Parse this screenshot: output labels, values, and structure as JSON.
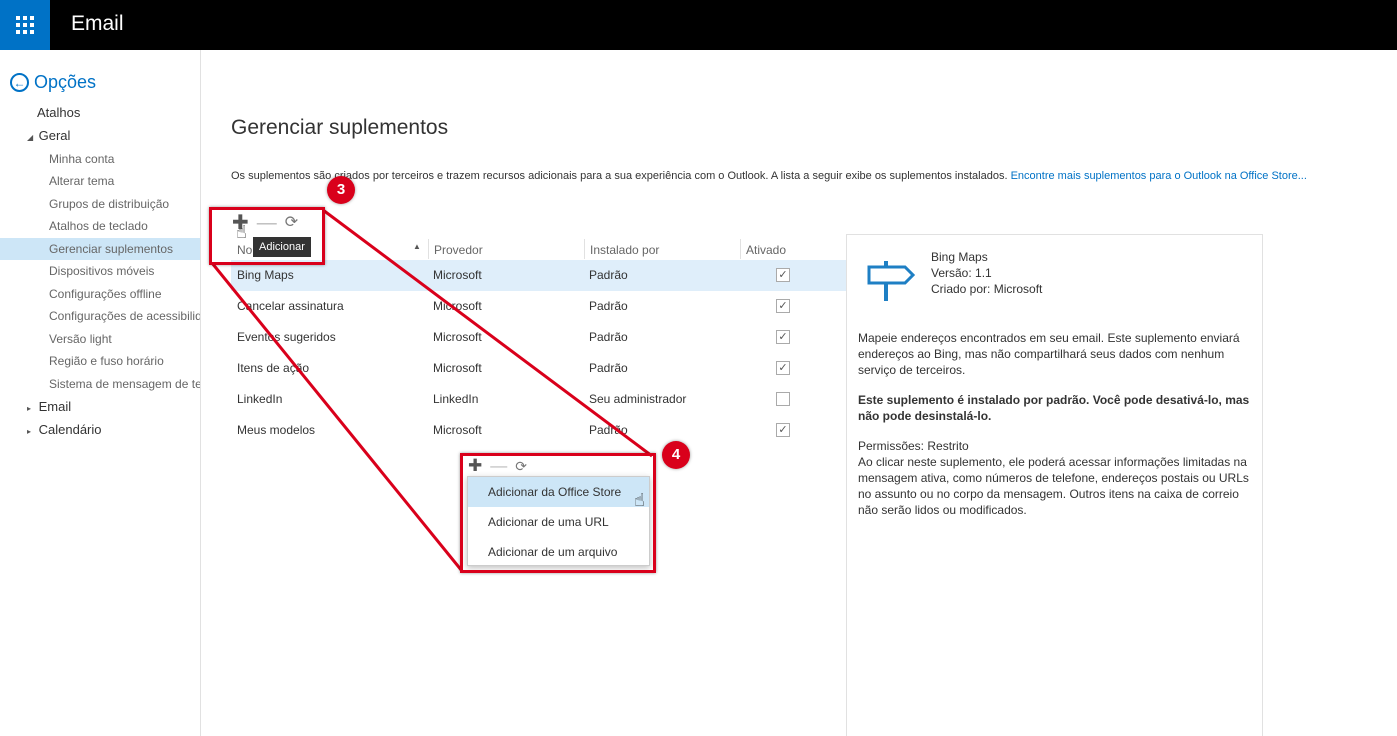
{
  "header": {
    "title": "Email",
    "waffle_icon": "app-launcher-icon"
  },
  "nav": {
    "back_label": "Opções",
    "items": [
      {
        "label": "Atalhos",
        "level": "top"
      },
      {
        "label": "Geral",
        "level": "top",
        "expanded": true
      },
      {
        "label": "Minha conta"
      },
      {
        "label": "Alterar tema"
      },
      {
        "label": "Grupos de distribuição"
      },
      {
        "label": "Atalhos de teclado"
      },
      {
        "label": "Gerenciar suplementos",
        "selected": true
      },
      {
        "label": "Dispositivos móveis"
      },
      {
        "label": "Configurações offline"
      },
      {
        "label": "Configurações de acessibilidade"
      },
      {
        "label": "Versão light"
      },
      {
        "label": "Região e fuso horário"
      },
      {
        "label": "Sistema de mensagem de texto"
      },
      {
        "label": "Email",
        "level": "top",
        "expanded": false
      },
      {
        "label": "Calendário",
        "level": "top",
        "expanded": false
      }
    ]
  },
  "main": {
    "title": "Gerenciar suplementos",
    "intro": "Os suplementos são criados por terceiros e trazem recursos adicionais para a sua experiência com o Outlook. A lista a seguir exibe os suplementos instalados.",
    "intro_link": "Encontre mais suplementos para o Outlook na Office Store...",
    "tooltip": "Adicionar",
    "columns": [
      "Nome",
      "Provedor",
      "Instalado por",
      "Ativado"
    ],
    "rows": [
      {
        "name": "Bing Maps",
        "provider": "Microsoft",
        "installed_by": "Padrão",
        "enabled": true,
        "selected": true
      },
      {
        "name": "Cancelar assinatura",
        "provider": "Microsoft",
        "installed_by": "Padrão",
        "enabled": true
      },
      {
        "name": "Eventos sugeridos",
        "provider": "Microsoft",
        "installed_by": "Padrão",
        "enabled": true
      },
      {
        "name": "Itens de ação",
        "provider": "Microsoft",
        "installed_by": "Padrão",
        "enabled": true
      },
      {
        "name": "LinkedIn",
        "provider": "LinkedIn",
        "installed_by": "Seu administrador",
        "enabled": false
      },
      {
        "name": "Meus modelos",
        "provider": "Microsoft",
        "installed_by": "Padrão",
        "enabled": true
      }
    ],
    "add_menu": [
      "Adicionar da Office Store",
      "Adicionar de uma URL",
      "Adicionar de um arquivo"
    ]
  },
  "details": {
    "name": "Bing Maps",
    "version": "Versão: 1.1",
    "created_by": "Criado por: Microsoft",
    "description": "Mapeie endereços encontrados em seu email. Este suplemento enviará endereços ao Bing, mas não compartilhará seus dados com nenhum serviço de terceiros.",
    "notice": "Este suplemento é instalado por padrão. Você pode desativá-lo, mas não pode desinstalá-lo.",
    "permissions": "Permissões: Restrito",
    "permissions_desc": "Ao clicar neste suplemento, ele poderá acessar informações limitadas na mensagem ativa, como números de telefone, endereços postais ou URLs no assunto ou no corpo da mensagem. Outros itens na caixa de correio não serão lidos ou modificados."
  },
  "annotations": {
    "step_a": "3",
    "step_b": "4",
    "color": "#d9001b"
  },
  "colors": {
    "accent": "#0072c6",
    "selected_row": "#dfeefa",
    "selected_nav": "#cde6f7"
  }
}
